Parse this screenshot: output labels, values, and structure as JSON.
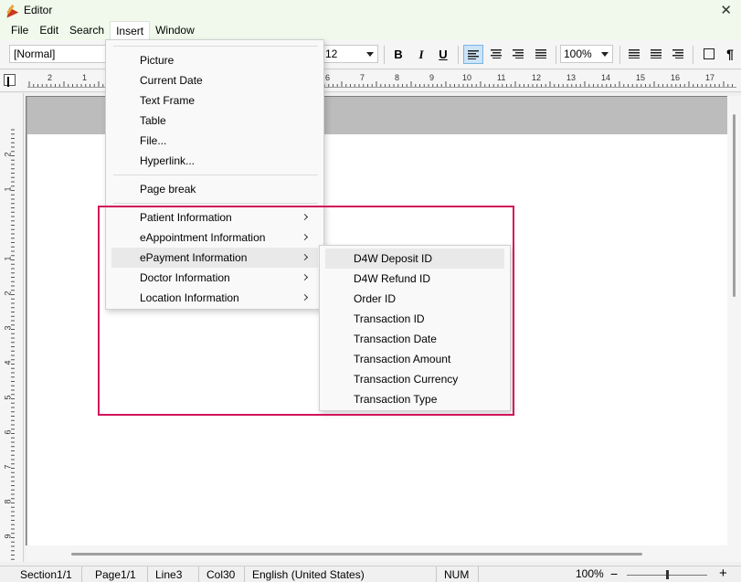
{
  "window": {
    "title": "Editor"
  },
  "menubar": {
    "items": [
      "File",
      "Edit",
      "Search",
      "Insert",
      "Window"
    ],
    "active": "Insert"
  },
  "toolbar": {
    "style_value": "[Normal]",
    "font_size_value": "12",
    "bold_label": "B",
    "italic_label": "I",
    "underline_label": "U",
    "zoom_value": "100%",
    "pilcrow": "¶"
  },
  "ruler": {
    "numbers": [
      "2",
      "1",
      "6",
      "7",
      "8",
      "9",
      "10",
      "11",
      "12",
      "13",
      "14",
      "15",
      "16",
      "17"
    ]
  },
  "vruler": {
    "numbers": [
      "2",
      "1",
      "1",
      "2",
      "3",
      "4",
      "5",
      "6",
      "7",
      "8",
      "9"
    ]
  },
  "insert_menu": {
    "items": [
      {
        "label": "Picture"
      },
      {
        "label": "Current Date"
      },
      {
        "label": "Text Frame"
      },
      {
        "label": "Table"
      },
      {
        "label": "File..."
      },
      {
        "label": "Hyperlink..."
      }
    ],
    "page_break": "Page break",
    "submenus": [
      {
        "label": "Patient Information"
      },
      {
        "label": "eAppointment Information"
      },
      {
        "label": "ePayment Information"
      },
      {
        "label": "Doctor Information"
      },
      {
        "label": "Location Information"
      }
    ]
  },
  "epayment_submenu": {
    "items": [
      "D4W Deposit ID",
      "D4W Refund ID",
      "Order ID",
      "Transaction ID",
      "Transaction Date",
      "Transaction Amount",
      "Transaction Currency",
      "Transaction Type"
    ]
  },
  "statusbar": {
    "section": "Section1/1",
    "page": "Page1/1",
    "line": "Line3",
    "col": "Col30",
    "language": "English (United States)",
    "num": "NUM",
    "zoom": "100%",
    "minus": "−",
    "plus": "+"
  },
  "colors": {
    "highlight": "#d3145a",
    "titlebar": "#f0f9eb"
  }
}
